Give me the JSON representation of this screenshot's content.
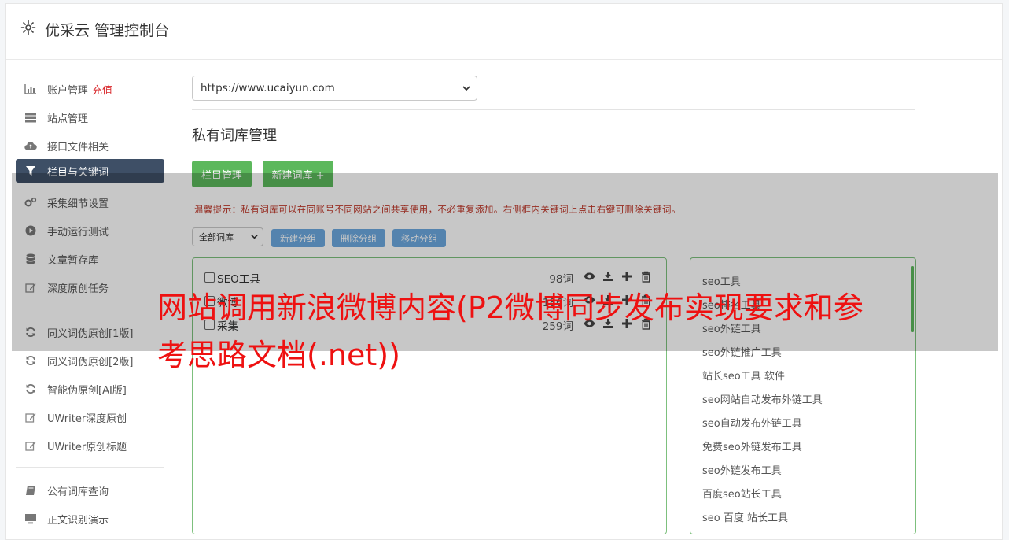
{
  "header": {
    "title": "优采云 管理控制台",
    "icon": "gear-icon"
  },
  "sidebar": {
    "items": [
      {
        "label": "账户管理",
        "badge": "充值",
        "icon": "bar-chart-icon"
      },
      {
        "label": "站点管理",
        "icon": "server-icon"
      },
      {
        "label": "接口文件相关",
        "icon": "cloud-upload-icon"
      },
      {
        "label": "栏目与关键词",
        "icon": "filter-icon",
        "active": true
      },
      {
        "label": "采集细节设置",
        "icon": "gears-icon"
      },
      {
        "label": "手动运行测试",
        "icon": "play-circle-icon"
      },
      {
        "label": "文章暂存库",
        "icon": "database-icon"
      },
      {
        "label": "深度原创任务",
        "icon": "edit-icon"
      },
      {
        "label": "同义词伪原创[1版]",
        "icon": "refresh-icon"
      },
      {
        "label": "同义词伪原创[2版]",
        "icon": "refresh-icon"
      },
      {
        "label": "智能伪原创[AI版]",
        "icon": "refresh-icon"
      },
      {
        "label": "UWriter深度原创",
        "icon": "edit-icon"
      },
      {
        "label": "UWriter原创标题",
        "icon": "edit-icon"
      },
      {
        "label": "公有词库查询",
        "icon": "book-icon"
      },
      {
        "label": "正文识别演示",
        "icon": "monitor-icon"
      }
    ]
  },
  "main": {
    "site_select": "https://www.ucaiyun.com",
    "section_title": "私有词库管理",
    "buttons": {
      "column_manage": "栏目管理",
      "new_library": "新建词库 +"
    },
    "tip": "温馨提示：私有词库可以在同账号不同网站之间共享使用，不必重复添加。右侧框内关键词上点击右键可删除关键词。",
    "group_select": "全部词库",
    "group_buttons": {
      "new": "新建分组",
      "delete": "删除分组",
      "move": "移动分组"
    },
    "libraries": [
      {
        "name": "SEO工具",
        "count": "98词"
      },
      {
        "name": "微博",
        "count": "186词"
      },
      {
        "name": "采集",
        "count": "259词"
      }
    ],
    "keywords": [
      "seo工具",
      "seo排名工具",
      "seo外链工具",
      "seo外链推广工具",
      "站长seo工具 软件",
      "seo网站自动发布外链工具",
      "seo自动发布外链工具",
      "免费seo外链发布工具",
      "seo外链发布工具",
      "百度seo站长工具",
      "seo 百度 站长工具"
    ]
  },
  "overlay_title": "网站调用新浪微博内容(P2微博同步发布实现要求和参考思路文档(.net))",
  "colors": {
    "accent_dark": "#3e4f66",
    "green": "#5cb85c",
    "blue": "#6ca8df",
    "tip_red": "#c0392b",
    "title_red": "#ee1111"
  }
}
